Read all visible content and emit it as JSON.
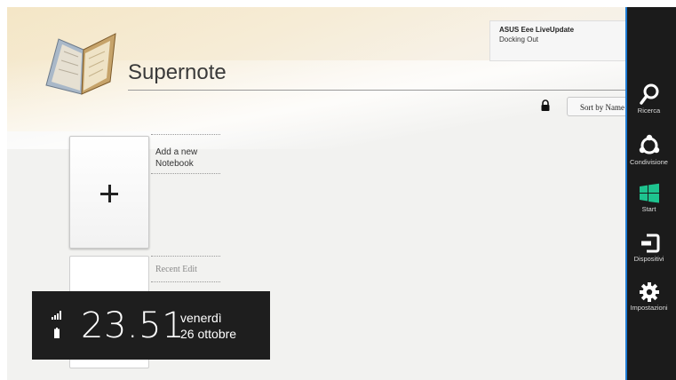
{
  "app": {
    "title": "Supernote"
  },
  "notification": {
    "title": "ASUS Eee LiveUpdate",
    "message": "Docking Out"
  },
  "toolbar": {
    "sort_label": "Sort by Name",
    "lock_icon": "lock-icon"
  },
  "notebooks": {
    "add_label": "Add a new Notebook",
    "recent_label": "Recent Edit"
  },
  "clock": {
    "time": "23.51",
    "day": "venerdì",
    "date": "26 ottobre"
  },
  "charms": {
    "accent": "#1e7bd4",
    "items": [
      {
        "label": "Ricerca",
        "icon": "search-icon"
      },
      {
        "label": "Condivisione",
        "icon": "share-icon"
      },
      {
        "label": "Start",
        "icon": "windows-logo-icon"
      },
      {
        "label": "Dispositivi",
        "icon": "devices-icon"
      },
      {
        "label": "Impostazioni",
        "icon": "gear-icon"
      }
    ]
  }
}
